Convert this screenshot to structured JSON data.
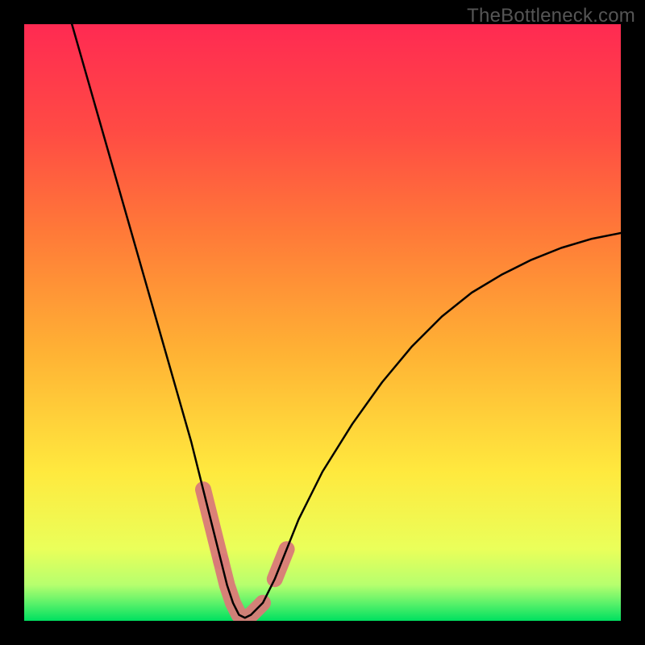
{
  "watermark": "TheBottleneck.com",
  "chart_data": {
    "type": "line",
    "title": "",
    "xlabel": "",
    "ylabel": "",
    "xlim": [
      0,
      100
    ],
    "ylim": [
      0,
      100
    ],
    "series": [
      {
        "name": "bottleneck-curve",
        "x": [
          8,
          10,
          12,
          14,
          16,
          18,
          20,
          22,
          24,
          26,
          28,
          30,
          31,
          32,
          33,
          34,
          35,
          36,
          37,
          38,
          40,
          42,
          44,
          46,
          50,
          55,
          60,
          65,
          70,
          75,
          80,
          85,
          90,
          95,
          100
        ],
        "y": [
          100,
          93,
          86,
          79,
          72,
          65,
          58,
          51,
          44,
          37,
          30,
          22,
          18,
          14,
          10,
          6,
          3,
          1,
          0.5,
          1,
          3,
          7,
          12,
          17,
          25,
          33,
          40,
          46,
          51,
          55,
          58,
          60.5,
          62.5,
          64,
          65
        ]
      }
    ],
    "highlight_segments": [
      {
        "name": "left-marker",
        "xrange": [
          30,
          33
        ],
        "yrange": [
          10,
          22
        ]
      },
      {
        "name": "valley-marker",
        "xrange": [
          33,
          41
        ],
        "yrange": [
          0.5,
          6
        ]
      },
      {
        "name": "right-marker",
        "xrange": [
          41,
          44
        ],
        "yrange": [
          7,
          14
        ]
      }
    ],
    "gradient_stops": [
      {
        "offset": 0.0,
        "color": "#00e060"
      },
      {
        "offset": 0.03,
        "color": "#5cf26a"
      },
      {
        "offset": 0.06,
        "color": "#b6ff6e"
      },
      {
        "offset": 0.12,
        "color": "#eaff5a"
      },
      {
        "offset": 0.25,
        "color": "#ffe93e"
      },
      {
        "offset": 0.45,
        "color": "#ffb234"
      },
      {
        "offset": 0.65,
        "color": "#ff7a38"
      },
      {
        "offset": 0.82,
        "color": "#ff4b44"
      },
      {
        "offset": 1.0,
        "color": "#ff2a52"
      }
    ],
    "curve_color": "#000000",
    "highlight_color": "#d97a78",
    "frame_color": "#000000"
  }
}
